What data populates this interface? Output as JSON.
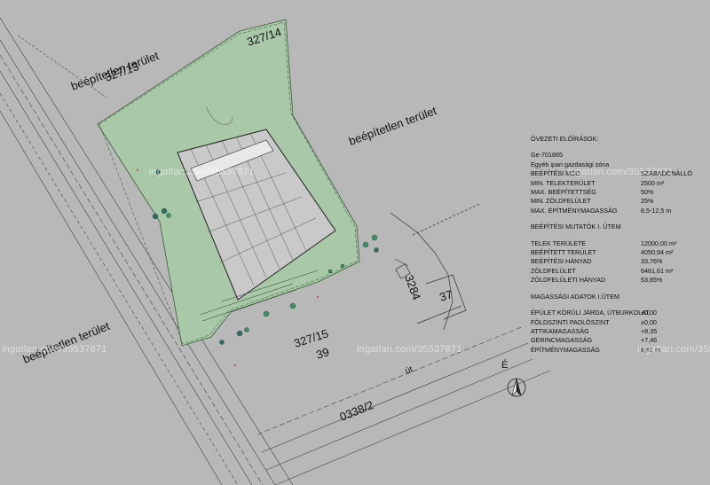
{
  "plot_labels": {
    "undeveloped_top_left": "beépítetlen terület",
    "undeveloped_right": "beépítetlen terület",
    "undeveloped_bottom_left": "beépítetlen terület",
    "parcel_327_14": "327/14",
    "parcel_327_13": "327/13",
    "parcel_327_15": "327/15",
    "parcel_39": "39",
    "parcel_3284": "3284",
    "parcel_37": "37",
    "parcel_0338_2": "0338/2",
    "road_ut": "út"
  },
  "regulations": {
    "zoning_title": "ÖVEZETI ELŐÍRÁSOK:",
    "zone_code": "Ge-701865",
    "zone_description": "Egyéb ipari gazdasági zóna",
    "rows": [
      {
        "label": "BEÉPÍTÉSI MÓD",
        "value": "SZABADONÁLLÓ"
      },
      {
        "label": "MIN. TELEKTERÜLET",
        "value": "2500 m²"
      },
      {
        "label": "MAX. BEÉPÍTETTSÉG",
        "value": "50%"
      },
      {
        "label": "MIN. ZÖLDFELÜLET",
        "value": "25%"
      },
      {
        "label": "MAX. ÉPÍTMÉNYMAGASSÁG",
        "value": "8,5-12,5 m"
      }
    ],
    "indicators_title": "BEÉPÍTÉSI MUTATÓK I. ÜTEM",
    "indicators": [
      {
        "label": "TELEK TERÜLETE",
        "value": "12000,00 m²"
      },
      {
        "label": "BEÉPÍTETT TERÜLET",
        "value": "4050,94 m²"
      },
      {
        "label": "BEÉPÍTÉSI HÁNYAD",
        "value": "33,76%"
      },
      {
        "label": "ZÖLDFELÜLET",
        "value": "6461,61 m²"
      },
      {
        "label": "ZÖLDFELÜLETI HÁNYAD",
        "value": "53,85%"
      }
    ],
    "heights_title": "MAGASSÁGI ADATOK I.ÜTEM",
    "heights": [
      {
        "label": "ÉPÜLET KÖRÜLI JÁRDA, ÚTBURKOLAT",
        "value": "±0,00"
      },
      {
        "label": "FÖLDSZINTI PADLÓSZINT",
        "value": "±0,00"
      },
      {
        "label": "ATTIKAMAGASSÁG",
        "value": "+8,35"
      },
      {
        "label": "GERINCMAGASSÁG",
        "value": "+7,46"
      },
      {
        "label": "ÉPÍTMÉNYMAGASSÁG",
        "value": "8,61 m"
      }
    ]
  },
  "north_arrow_label": "É",
  "watermarks": [
    "ingatlan.com/35537871",
    "ingatlan.com/35537871",
    "ingatlan.com/35537871",
    "ingatlan.com/35537871"
  ],
  "colors": {
    "background": "#b8b8b8",
    "green_area": "#a9c8a8",
    "line": "#333333"
  }
}
